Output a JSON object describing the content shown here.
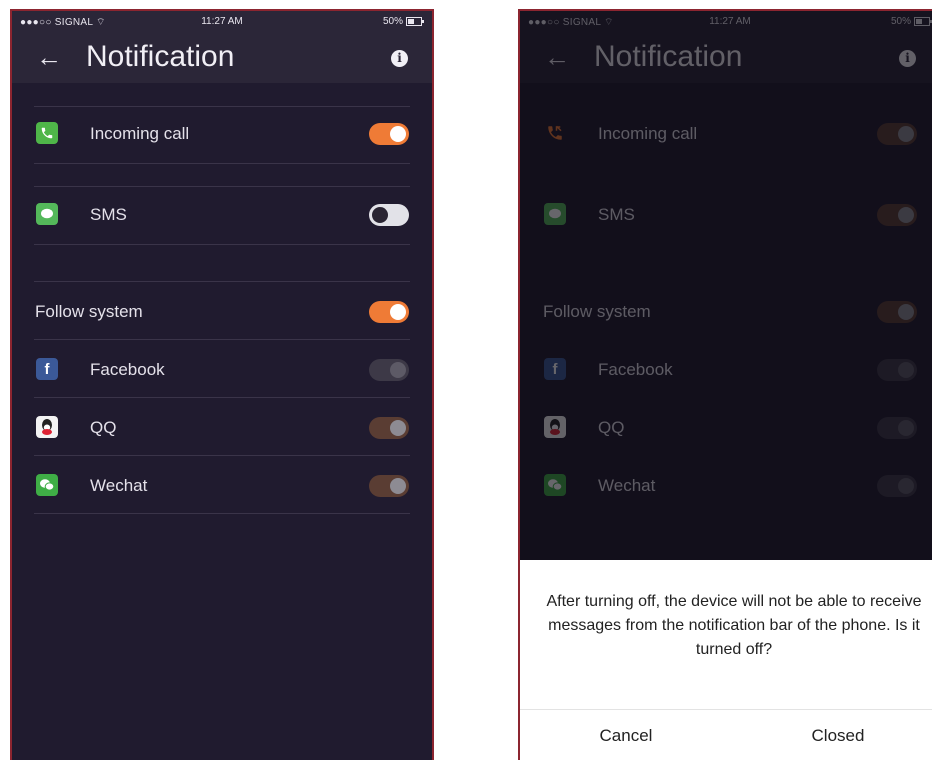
{
  "status_bar": {
    "carrier": "●●●○○ SIGNAL ⌔",
    "time": "11:27 AM",
    "battery": "50%"
  },
  "nav": {
    "back": "←",
    "title": "Notification",
    "info": "i"
  },
  "rows": [
    {
      "label": "Incoming call",
      "icon": "phone-icon",
      "state": "on"
    },
    {
      "label": "SMS",
      "icon": "message-icon",
      "state": "off"
    },
    {
      "label": "Follow system",
      "state": "on"
    },
    {
      "label": "Facebook",
      "icon": "facebook-icon",
      "glyph": "f",
      "state": "dim-off"
    },
    {
      "label": "QQ",
      "icon": "qq-icon",
      "state": "dim-on"
    },
    {
      "label": "Wechat",
      "icon": "wechat-icon",
      "state": "dim-on"
    }
  ],
  "right_toggle_states": [
    "dim-on",
    "dim-on",
    "dim-on",
    "dim-off",
    "dim-off",
    "dim-off"
  ],
  "dialog": {
    "message": "After turning off, the device will not be able to receive messages from the notification bar of the phone. Is it turned off?",
    "cancel": "Cancel",
    "confirm": "Closed"
  },
  "colors": {
    "accent": "#ef7b36",
    "background": "#201b2f",
    "header": "#2b2638",
    "frame": "#8c2530"
  }
}
